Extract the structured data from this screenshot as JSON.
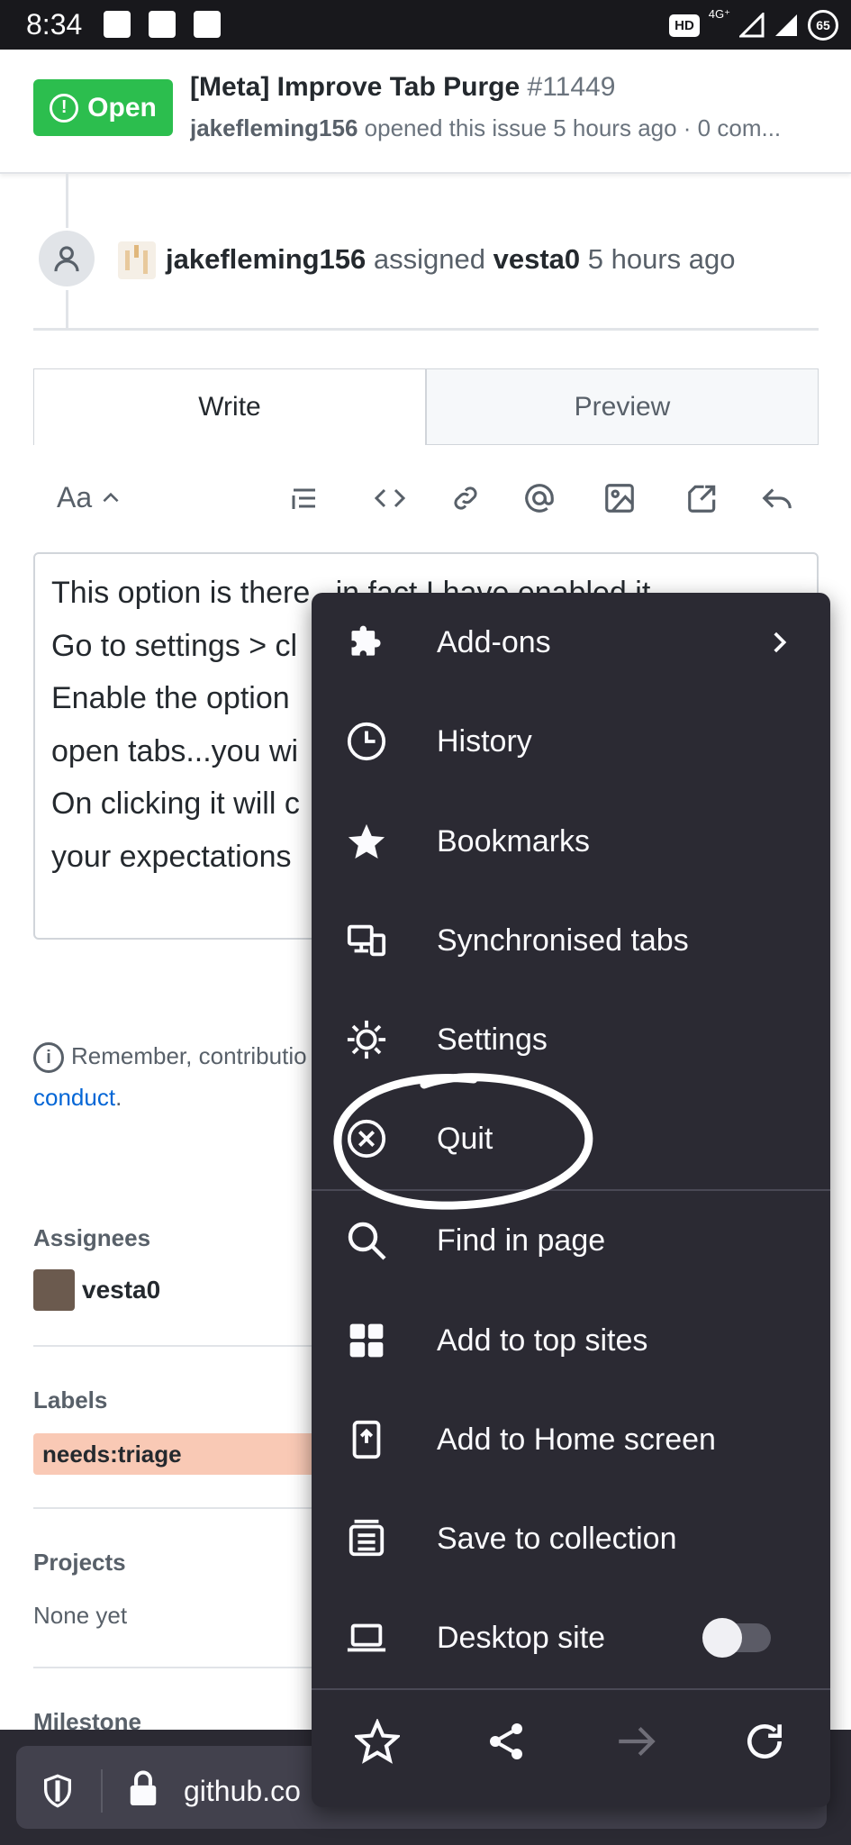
{
  "status_bar": {
    "time": "8:34",
    "network": "4G⁺",
    "hd_badge": "HD",
    "battery": "65"
  },
  "issue": {
    "status_label": "Open",
    "title": "[Meta] Improve Tab Purge",
    "number": "#11449",
    "author": "jakefleming156",
    "meta_rest": " opened this issue 5 hours ago · 0 com..."
  },
  "timeline_event": {
    "actor": "jakefleming156",
    "action": " assigned ",
    "assignee": "vesta0",
    "time": " 5 hours ago"
  },
  "editor": {
    "tabs": [
      "Write",
      "Preview"
    ],
    "format_label": "Aa",
    "lines": [
      "This option is there...in fact I have enabled it",
      "Go to settings > cl",
      "Enable the option",
      "open tabs...you wi",
      "On clicking it will c",
      "your expectations"
    ]
  },
  "remember_note": {
    "text": "Remember, contributio",
    "link": "conduct",
    "link_suffix": "."
  },
  "sidebar": {
    "assignees_label": "Assignees",
    "assignee": "vesta0",
    "labels_label": "Labels",
    "label": "needs:triage",
    "projects_label": "Projects",
    "projects_value": "None yet",
    "milestone_label": "Milestone"
  },
  "url_bar": {
    "url": "github.co"
  },
  "menu": {
    "items": [
      {
        "label": "Add-ons",
        "icon": "puzzle-icon"
      },
      {
        "label": "History",
        "icon": "clock-icon"
      },
      {
        "label": "Bookmarks",
        "icon": "star-icon"
      },
      {
        "label": "Synchronised tabs",
        "icon": "devices-icon"
      },
      {
        "label": "Settings",
        "icon": "gear-icon"
      },
      {
        "label": "Quit",
        "icon": "close-circle-icon"
      },
      {
        "label": "Find in page",
        "icon": "search-icon"
      },
      {
        "label": "Add to top sites",
        "icon": "grid-icon"
      },
      {
        "label": "Add to Home screen",
        "icon": "add-home-icon"
      },
      {
        "label": "Save to collection",
        "icon": "collection-icon"
      },
      {
        "label": "Desktop site",
        "icon": "laptop-icon"
      }
    ],
    "desktop_site_enabled": false,
    "forward_enabled": false
  },
  "colors": {
    "open_green": "#2cbe4e",
    "menu_bg": "#2b2a33",
    "link_blue": "#0366d6",
    "label_bg": "#f9c9b5"
  }
}
